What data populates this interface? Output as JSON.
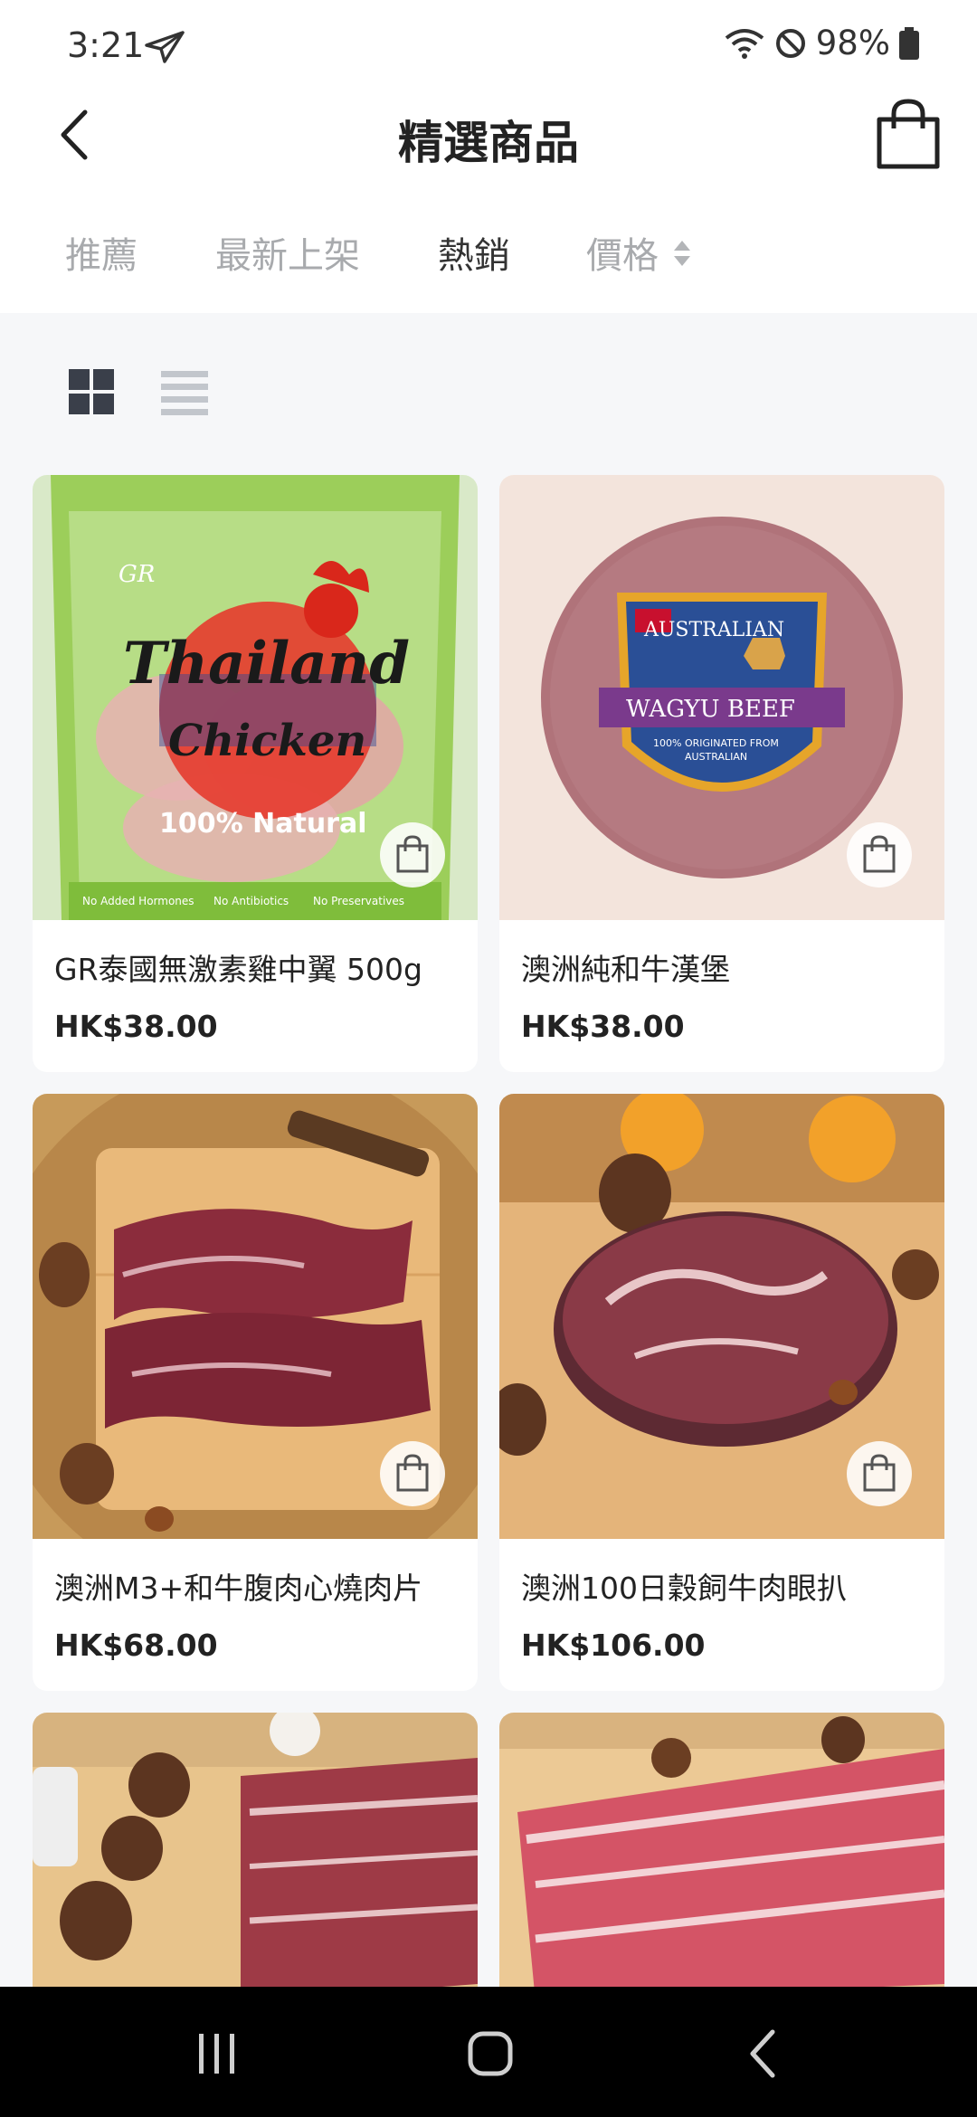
{
  "status_bar": {
    "time": "3:21",
    "battery": "98%"
  },
  "header": {
    "title": "精選商品",
    "back_icon": "chevron-left-icon",
    "cart_icon": "shopping-bag-icon"
  },
  "tabs": [
    {
      "label": "推薦"
    },
    {
      "label": "最新上架"
    },
    {
      "label": "熱銷"
    },
    {
      "label": "價格"
    }
  ],
  "active_tab": "熱銷",
  "view_toggle": {
    "selected": "grid"
  },
  "products": [
    {
      "name": "GR泰國無激素雞中翼 500g",
      "price": "HK$38.00",
      "image_text": [
        "GR",
        "Thailand",
        "Chicken",
        "100% Natural",
        "No Added Hormones",
        "No Antibiotics",
        "No Preservatives"
      ]
    },
    {
      "name": "澳洲純和牛漢堡",
      "price": "HK$38.00",
      "image_text": [
        "AUSTRALIAN",
        "WAGYU BEEF",
        "100% ORIGINATED FROM",
        "AUSTRALIAN"
      ]
    },
    {
      "name": "澳洲M3+和牛腹肉心燒肉片",
      "price": "HK$68.00"
    },
    {
      "name": "澳洲100日穀飼牛肉眼扒",
      "price": "HK$106.00"
    },
    {
      "name": "",
      "price": ""
    },
    {
      "name": "",
      "price": ""
    }
  ],
  "colors": {
    "page_bg": "#f6f7f9",
    "header_bg": "#ffffff",
    "active_tab": "#333333",
    "inactive_tab": "#a8aaad",
    "nav_bar": "#000000"
  }
}
